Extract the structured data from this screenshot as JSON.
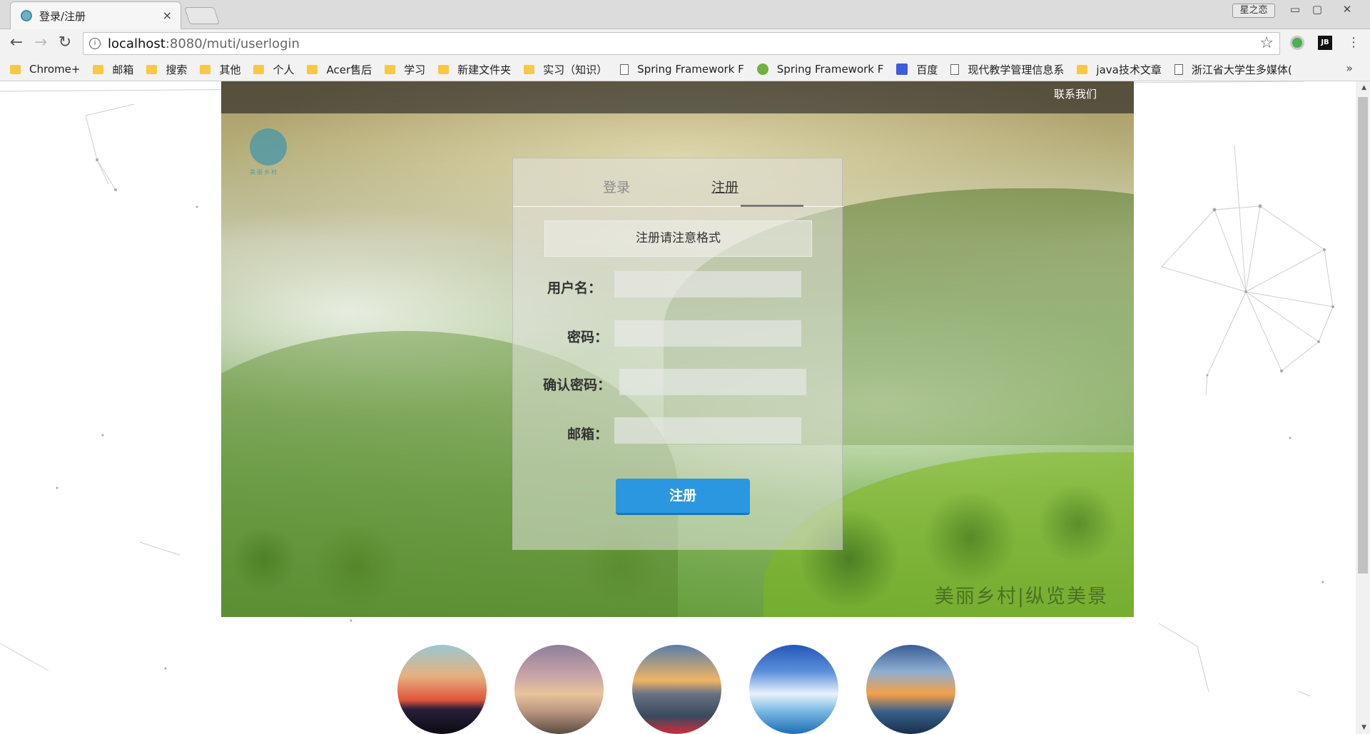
{
  "browser": {
    "tab_title": "登录/注册",
    "tab_close": "×",
    "profile_label": "星之恋",
    "window_controls": [
      "▭",
      "▢",
      "✕"
    ],
    "url_host": "localhost",
    "url_rest": ":8080/muti/userlogin",
    "nav": {
      "back": "←",
      "forward": "→",
      "reload": "↻",
      "star": "☆"
    },
    "extension_label": "JB",
    "bookmarks_more": "»",
    "bookmarks": [
      {
        "label": "Chrome+",
        "icon": "folder-icon"
      },
      {
        "label": "邮箱",
        "icon": "folder-icon"
      },
      {
        "label": "搜索",
        "icon": "folder-icon"
      },
      {
        "label": "其他",
        "icon": "folder-icon"
      },
      {
        "label": "个人",
        "icon": "folder-icon"
      },
      {
        "label": "Acer售后",
        "icon": "folder-icon"
      },
      {
        "label": "学习",
        "icon": "folder-icon"
      },
      {
        "label": "新建文件夹",
        "icon": "folder-icon"
      },
      {
        "label": "实习（知识）",
        "icon": "folder-icon"
      },
      {
        "label": "Spring Framework F",
        "icon": "page-icon"
      },
      {
        "label": "Spring Framework F",
        "icon": "spring-leaf-icon"
      },
      {
        "label": "百度",
        "icon": "baidu-paw-icon"
      },
      {
        "label": "现代教学管理信息系",
        "icon": "page-icon"
      },
      {
        "label": "java技术文章",
        "icon": "folder-icon"
      },
      {
        "label": "浙江省大学生多媒体(",
        "icon": "page-icon"
      }
    ]
  },
  "page": {
    "contact_link": "联系我们",
    "logo_text": "美丽乡村",
    "slogan": "美丽乡村|纵览美景",
    "form": {
      "tab_login": "登录",
      "tab_register": "注册",
      "notice": "注册请注意格式",
      "fields": [
        {
          "label": "用户名：",
          "placeholder": ""
        },
        {
          "label": "密码：",
          "placeholder": ""
        },
        {
          "label": "确认密码：",
          "placeholder": ""
        },
        {
          "label": "邮箱：",
          "placeholder": ""
        }
      ],
      "submit_label": "注册"
    },
    "thumbnails": [
      "sunset-thumbnail",
      "pier-sunset-thumbnail",
      "lake-flowers-thumbnail",
      "blue-sky-thumbnail",
      "boat-sunset-thumbnail"
    ]
  },
  "colors": {
    "accent_button": "#2b97e0",
    "topbar": "rgba(40,40,40,0.65)"
  }
}
